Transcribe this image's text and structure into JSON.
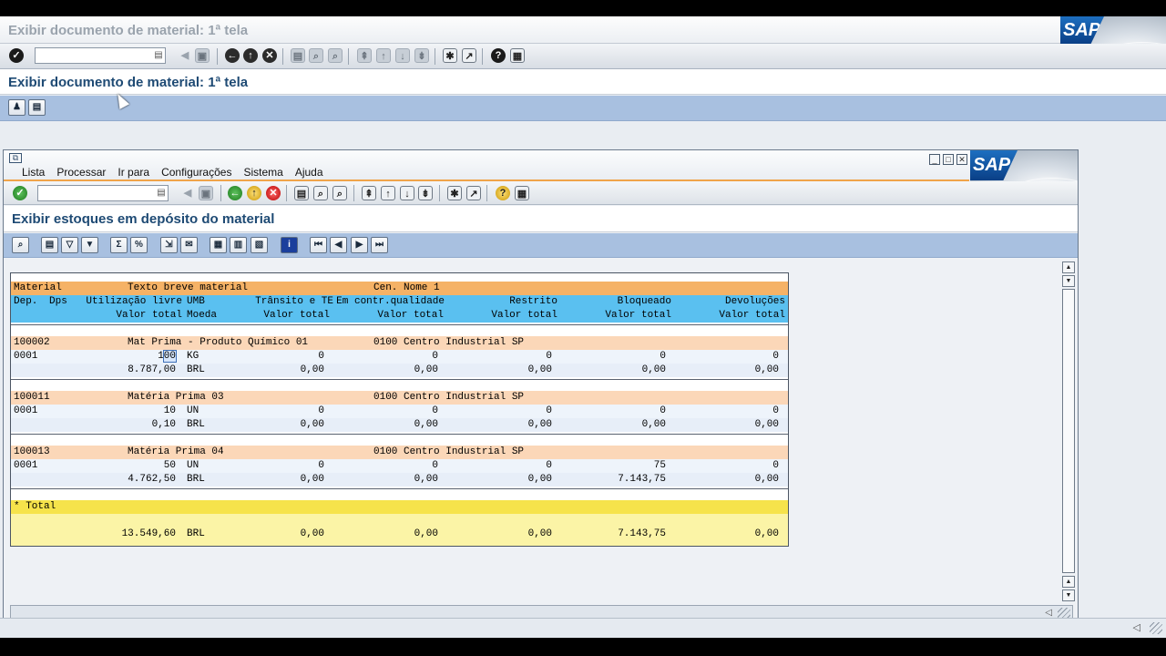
{
  "window": {
    "title": "Exibir documento de material: 1ª tela",
    "logo": "SAP"
  },
  "system_toolbar": {
    "command_field": "",
    "icons": [
      "enter-icon",
      "back-icon",
      "exit-icon",
      "cancel-icon",
      "print-icon",
      "find-icon",
      "find-next-icon",
      "first-page-icon",
      "previous-page-icon",
      "next-page-icon",
      "last-page-icon",
      "create-session-icon",
      "shortcut-icon",
      "help-icon",
      "customize-layout-icon"
    ]
  },
  "screen": {
    "heading": "Exibir documento de material: 1ª tela"
  },
  "dialog": {
    "logo": "SAP",
    "menu": [
      "Lista",
      "Processar",
      "Ir para",
      "Configurações",
      "Sistema",
      "Ajuda"
    ],
    "heading": "Exibir estoques em depósito do material",
    "alv_buttons": [
      "details-icon",
      "print-icon",
      "filter-icon",
      "set-filter-icon",
      "sum-icon",
      "subtotal-icon",
      "export-icon",
      "send-icon",
      "layout-icon",
      "change-layout-icon",
      "save-layout-icon",
      "info-icon",
      "first-icon",
      "previous-icon",
      "next-icon",
      "last-icon"
    ]
  },
  "list": {
    "header1": {
      "material": "Material",
      "text": "Texto breve material",
      "cen": "Cen. Nome 1"
    },
    "header2": {
      "dep": "Dep.",
      "dps": "Dps",
      "util": "Utilização livre",
      "umb": "UMB",
      "transit": "Trânsito e TE",
      "qual": "Em contr.qualidade",
      "restrito": "Restrito",
      "bloqueado": "Bloqueado",
      "devol": "Devoluções"
    },
    "header3": {
      "valor": "Valor total",
      "moeda": "Moeda",
      "v1": "Valor total",
      "v2": "Valor total",
      "v3": "Valor total",
      "v4": "Valor total",
      "v5": "Valor total"
    },
    "groups": [
      {
        "material": "100002",
        "text": "Mat Prima - Produto Químico 01",
        "cen": "0100 Centro Industrial SP",
        "dep": "0001",
        "qty": "100",
        "umb": "KG",
        "q": [
          "0",
          "0",
          "0",
          "0",
          "0"
        ],
        "valor": "8.787,00",
        "moeda": "BRL",
        "v": [
          "0,00",
          "0,00",
          "0,00",
          "0,00",
          "0,00"
        ]
      },
      {
        "material": "100011",
        "text": "Matéria Prima 03",
        "cen": "0100 Centro Industrial SP",
        "dep": "0001",
        "qty": "10",
        "umb": "UN",
        "q": [
          "0",
          "0",
          "0",
          "0",
          "0"
        ],
        "valor": "0,10",
        "moeda": "BRL",
        "v": [
          "0,00",
          "0,00",
          "0,00",
          "0,00",
          "0,00"
        ]
      },
      {
        "material": "100013",
        "text": "Matéria Prima 04",
        "cen": "0100 Centro Industrial SP",
        "dep": "0001",
        "qty": "50",
        "umb": "UN",
        "q": [
          "0",
          "0",
          "0",
          "75",
          "0"
        ],
        "valor": "4.762,50",
        "moeda": "BRL",
        "v": [
          "0,00",
          "0,00",
          "0,00",
          "7.143,75",
          "0,00"
        ]
      }
    ],
    "total": {
      "label": "* Total",
      "valor": "13.549,60",
      "moeda": "BRL",
      "v": [
        "0,00",
        "0,00",
        "0,00",
        "7.143,75",
        "0,00"
      ]
    }
  }
}
